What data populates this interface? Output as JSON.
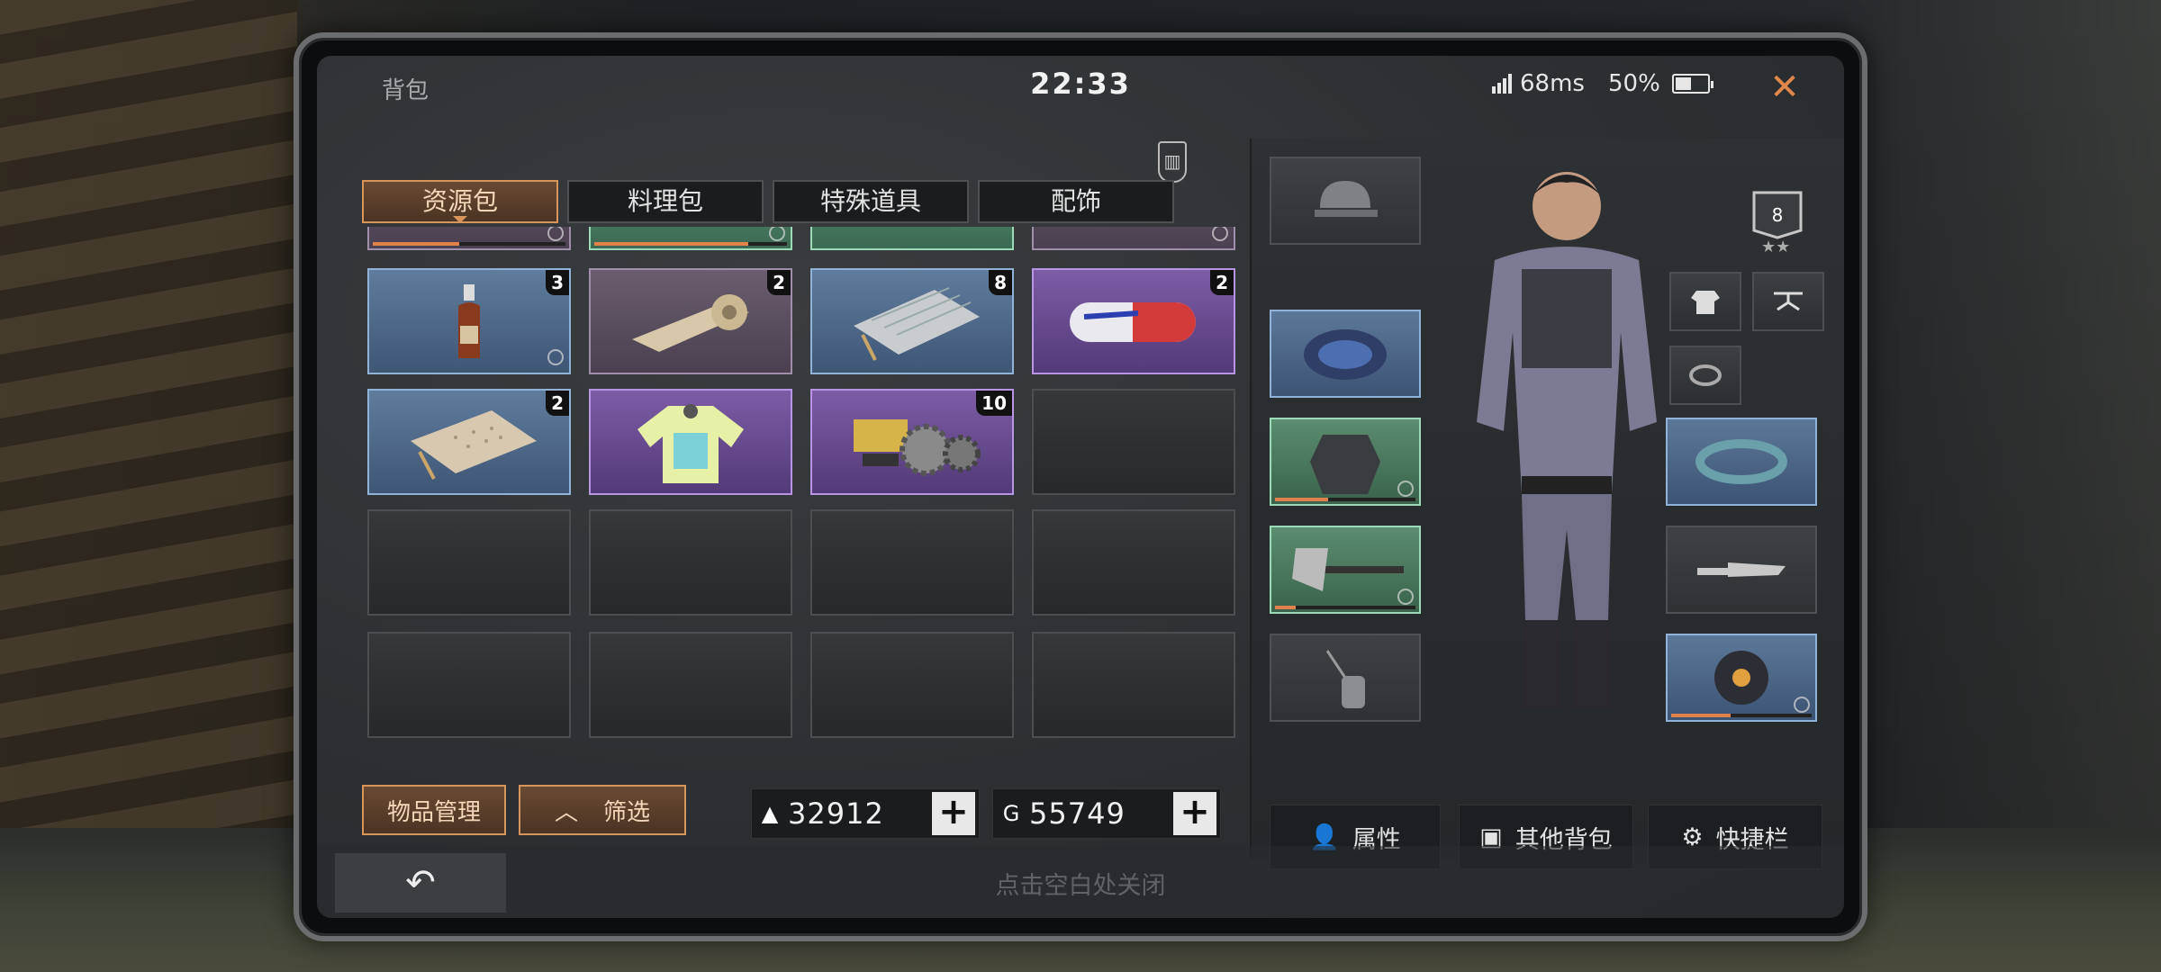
{
  "header": {
    "title": "背包",
    "clock": "22:33",
    "ping": "68ms",
    "battery": "50%",
    "battery_level": 0.5,
    "close_icon": "close-icon"
  },
  "tabs": [
    {
      "label": "资源包",
      "active": true
    },
    {
      "label": "料理包",
      "active": false
    },
    {
      "label": "特殊道具",
      "active": false
    },
    {
      "label": "配饰",
      "active": false
    }
  ],
  "inventory": {
    "rows": [
      [
        {
          "item": "partial-item",
          "rarity": "brown"
        },
        {
          "item": "partial-item",
          "rarity": "green"
        },
        {
          "item": "partial-item",
          "rarity": "green"
        },
        {
          "item": "partial-item",
          "rarity": "brown"
        }
      ],
      [
        {
          "item": "medicine-bottle",
          "rarity": "blue",
          "count": "3"
        },
        {
          "item": "bandage-roll",
          "rarity": "brown",
          "count": "2"
        },
        {
          "item": "metal-sheet",
          "rarity": "blue",
          "count": "8"
        },
        {
          "item": "pill-capsule",
          "rarity": "purple",
          "count": "2"
        }
      ],
      [
        {
          "item": "fabric-sheet",
          "rarity": "blue",
          "count": "2"
        },
        {
          "item": "jersey-shirt",
          "rarity": "purple",
          "count": ""
        },
        {
          "item": "gears-parts",
          "rarity": "purple",
          "count": "10"
        },
        {
          "item": "empty",
          "rarity": "empty",
          "count": ""
        }
      ]
    ]
  },
  "actions": {
    "manage_label": "物品管理",
    "filter_label": "筛选"
  },
  "currency": [
    {
      "icon": "silver-bar-icon",
      "value": "32912"
    },
    {
      "icon": "gold-coin-icon",
      "value": "55749"
    }
  ],
  "equipment": {
    "level_badge": "8",
    "buttons": {
      "attributes": "属性",
      "other_bags": "其他背包",
      "shortcut": "快捷栏"
    }
  },
  "footer": {
    "hint": "点击空白处关闭"
  }
}
